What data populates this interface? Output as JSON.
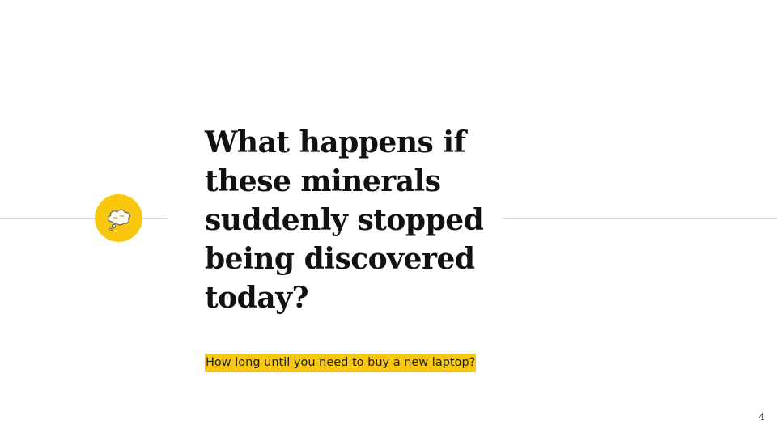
{
  "slide": {
    "headline_lines": [
      "What happens if",
      "these minerals",
      "suddenly stopped",
      "being discovered",
      "today?"
    ],
    "subtitle": "How long until you need to buy a new laptop?",
    "page_number": "4",
    "icon": "thought-bubble-icon"
  },
  "colors": {
    "accent": "#f9c80e",
    "rule": "#d9d9d9",
    "text": "#111111"
  }
}
